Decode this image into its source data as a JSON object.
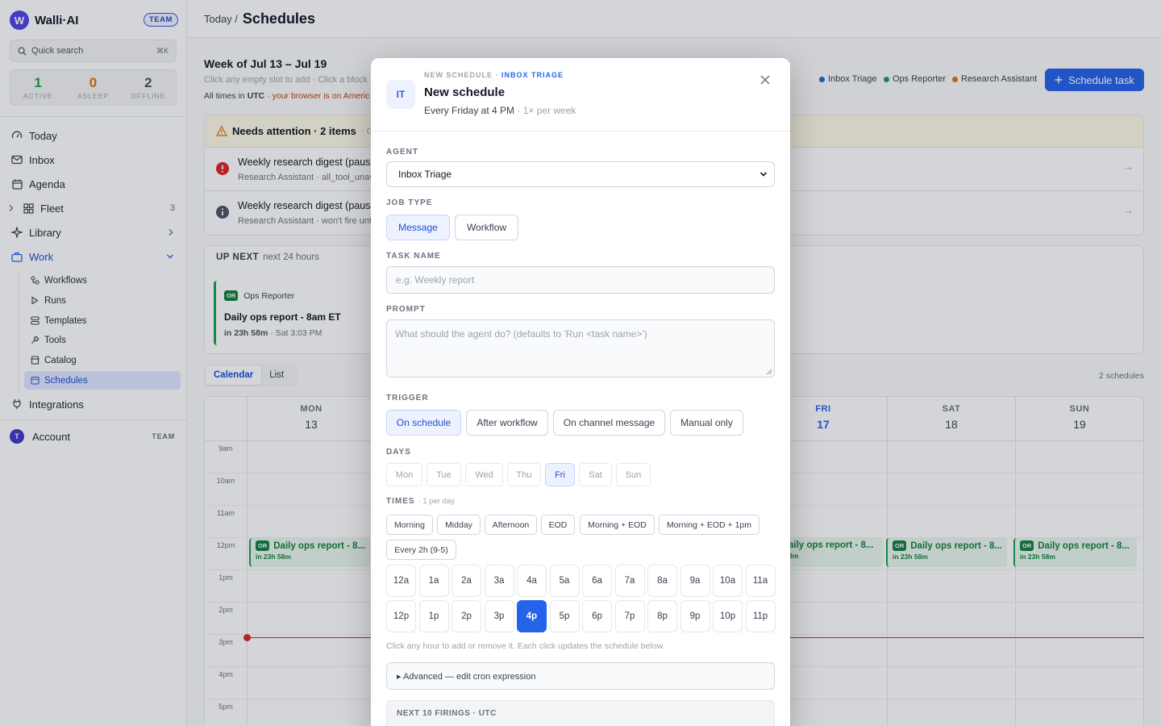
{
  "sidebar": {
    "brand_initial": "W",
    "brand_name": "Walli·AI",
    "team_badge": "TEAM",
    "search_placeholder": "Quick search",
    "search_kbd": "⌘K",
    "stats": [
      {
        "value": "1",
        "label": "ACTIVE",
        "color": "#16a34a"
      },
      {
        "value": "0",
        "label": "ASLEEP",
        "color": "#d97706"
      },
      {
        "value": "2",
        "label": "OFFLINE",
        "color": "#4b5563"
      }
    ],
    "nav": {
      "today": "Today",
      "inbox": "Inbox",
      "agenda": "Agenda",
      "fleet": "Fleet",
      "fleet_count": "3",
      "library": "Library",
      "work": "Work"
    },
    "work_items": {
      "workflows": "Workflows",
      "runs": "Runs",
      "templates": "Templates",
      "tools": "Tools",
      "catalog": "Catalog",
      "schedules": "Schedules"
    },
    "integrations": "Integrations",
    "account": {
      "initial": "T",
      "label": "Account",
      "badge": "TEAM"
    }
  },
  "header": {
    "crumb": "Today /",
    "title": "Schedules"
  },
  "page": {
    "week": "Week of Jul 13 – Jul 19",
    "hint": "Click any empty slot to add · Click a block",
    "tz_prefix": "All times in",
    "tz": "UTC",
    "tz_warn": "· your browser is on Americ",
    "legend": [
      {
        "name": "Inbox Triage",
        "color": "#2563eb"
      },
      {
        "name": "Ops Reporter",
        "color": "#16a34a"
      },
      {
        "name": "Research Assistant",
        "color": "#d97706"
      }
    ],
    "schedule_button": "Schedule task",
    "attention": {
      "title": "Needs attention · 2 items",
      "rest": "· Cl",
      "rows": [
        {
          "title": "Weekly research digest (paus",
          "sub": "Research Assistant · all_tool_unav"
        },
        {
          "title": "Weekly research digest (paus",
          "sub": "Research Assistant · won't fire unt"
        }
      ]
    },
    "upnext": {
      "title": "UP NEXT",
      "window": "next 24 hours",
      "card": {
        "badge": "OR",
        "agent": "Ops Reporter",
        "title": "Daily ops report - 8am ET",
        "eta": "in 23h 58m",
        "when": "· Sat 3:03 PM"
      }
    },
    "view_tabs": [
      "Calendar",
      "List"
    ],
    "count": "2 schedules",
    "calendar": {
      "days": [
        {
          "name": "MON",
          "num": "13"
        },
        {
          "name": "FRI",
          "num": "17"
        },
        {
          "name": "SAT",
          "num": "18"
        },
        {
          "name": "SUN",
          "num": "19"
        }
      ],
      "hours": [
        "9am",
        "10am",
        "11am",
        "12pm",
        "1pm",
        "2pm",
        "3pm",
        "4pm",
        "5pm"
      ],
      "events": [
        {
          "badge": "OR",
          "title": "Daily ops report - 8...",
          "eta": "in 23h 58m"
        },
        {
          "badge": "",
          "title": "aily ops report - 8...",
          "eta": "8m"
        },
        {
          "badge": "OR",
          "title": "Daily ops report - 8...",
          "eta": "in 23h 58m"
        },
        {
          "badge": "OR",
          "title": "Daily ops report - 8...",
          "eta": "in 23h 58m"
        }
      ]
    }
  },
  "modal": {
    "icon": "IT",
    "eyebrow": "NEW SCHEDULE ·",
    "eyebrow_agent": "INBOX TRIAGE",
    "title": "New schedule",
    "summary": "Every Friday at 4 PM",
    "summary_freq": "· 1× per week",
    "agent_label": "AGENT",
    "agent_value": "Inbox Triage",
    "job_type_label": "JOB TYPE",
    "job_types": [
      "Message",
      "Workflow"
    ],
    "job_type_selected": "Message",
    "task_name_label": "TASK NAME",
    "task_name_placeholder": "e.g. Weekly report",
    "prompt_label": "PROMPT",
    "prompt_placeholder": "What should the agent do? (defaults to 'Run <task name>')",
    "trigger_label": "TRIGGER",
    "triggers": [
      "On schedule",
      "After workflow",
      "On channel message",
      "Manual only"
    ],
    "trigger_selected": "On schedule",
    "days_label": "DAYS",
    "days": [
      "Mon",
      "Tue",
      "Wed",
      "Thu",
      "Fri",
      "Sat",
      "Sun"
    ],
    "days_selected": [
      "Fri"
    ],
    "times_label": "TIMES",
    "times_note": "· 1 per day",
    "presets": [
      "Morning",
      "Midday",
      "Afternoon",
      "EOD",
      "Morning + EOD",
      "Morning + EOD + 1pm",
      "Every 2h (9-5)"
    ],
    "hours": [
      "12a",
      "1a",
      "2a",
      "3a",
      "4a",
      "5a",
      "6a",
      "7a",
      "8a",
      "9a",
      "10a",
      "11a",
      "12p",
      "1p",
      "2p",
      "3p",
      "4p",
      "5p",
      "6p",
      "7p",
      "8p",
      "9p",
      "10p",
      "11p"
    ],
    "hours_selected": [
      "4p"
    ],
    "hours_hint": "Click any hour to add or remove it. Each click updates the schedule below.",
    "advanced": "▸ Advanced — edit cron expression",
    "firings_title": "NEXT 10 FIRINGS · UTC"
  }
}
